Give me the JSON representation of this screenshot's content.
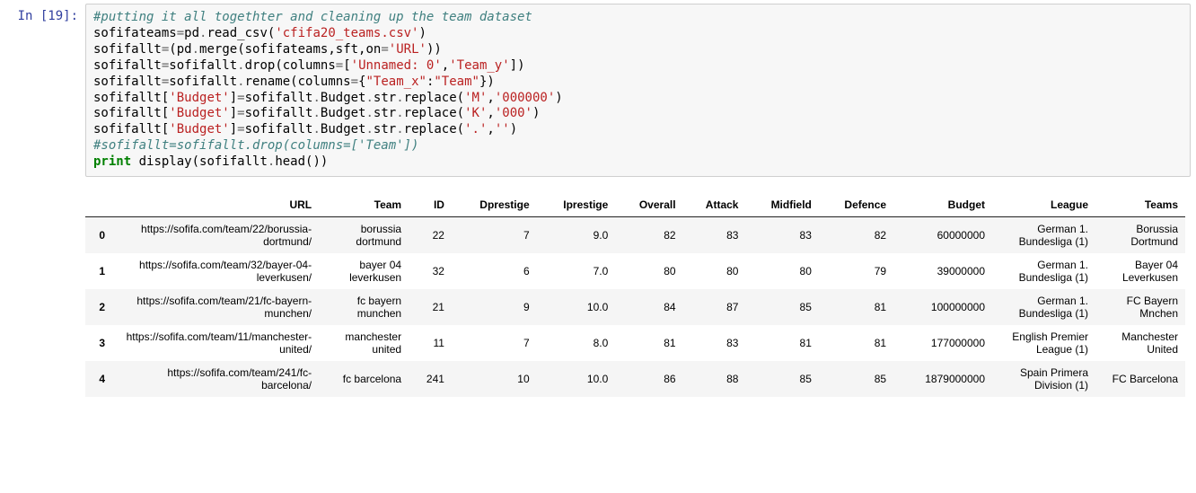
{
  "prompt": "In [19]:",
  "code": {
    "line1_comment": "#putting it all togethter and cleaning up the team dataset",
    "l2a": "sofifateams",
    "l2b": "pd",
    "l2c": "read_csv",
    "l2d": "'cfifa20_teams.csv'",
    "l3a": "sofifallt",
    "l3b": "pd",
    "l3c": "merge",
    "l3d": "sofifateams,sft,on",
    "l3e": "'URL'",
    "l4a": "sofifallt",
    "l4b": "sofifallt",
    "l4c": "drop",
    "l4d": "columns",
    "l4e": "'Unnamed: 0'",
    "l4f": "'Team_y'",
    "l5a": "sofifallt",
    "l5b": "sofifallt",
    "l5c": "rename",
    "l5d": "columns",
    "l5e": "\"Team_x\"",
    "l5f": "\"Team\"",
    "l6a": "sofifallt[",
    "l6b": "'Budget'",
    "l6c": "sofifallt",
    "l6d": "Budget",
    "l6e": "str",
    "l6f": "replace",
    "l6g": "'M'",
    "l6h": "'000000'",
    "l7g": "'K'",
    "l7h": "'000'",
    "l8g": "'.'",
    "l8h": "''",
    "l9_comment": "#sofifallt=sofifallt.drop(columns=['Team'])",
    "l10_kw": "print",
    "l10_rest": " display(sofifallt",
    "l10_head": "head",
    "l10_end": "())"
  },
  "table": {
    "headers": [
      "",
      "URL",
      "Team",
      "ID",
      "Dprestige",
      "Iprestige",
      "Overall",
      "Attack",
      "Midfield",
      "Defence",
      "Budget",
      "League",
      "Teams"
    ],
    "rows": [
      {
        "idx": "0",
        "URL": "https://sofifa.com/team/22/borussia-dortmund/",
        "Team": "borussia dortmund",
        "ID": "22",
        "Dprestige": "7",
        "Iprestige": "9.0",
        "Overall": "82",
        "Attack": "83",
        "Midfield": "83",
        "Defence": "82",
        "Budget": "60000000",
        "League": "German 1. Bundesliga (1)",
        "Teams": "Borussia Dortmund"
      },
      {
        "idx": "1",
        "URL": "https://sofifa.com/team/32/bayer-04-leverkusen/",
        "Team": "bayer 04 leverkusen",
        "ID": "32",
        "Dprestige": "6",
        "Iprestige": "7.0",
        "Overall": "80",
        "Attack": "80",
        "Midfield": "80",
        "Defence": "79",
        "Budget": "39000000",
        "League": "German 1. Bundesliga (1)",
        "Teams": "Bayer 04 Leverkusen"
      },
      {
        "idx": "2",
        "URL": "https://sofifa.com/team/21/fc-bayern-munchen/",
        "Team": "fc bayern munchen",
        "ID": "21",
        "Dprestige": "9",
        "Iprestige": "10.0",
        "Overall": "84",
        "Attack": "87",
        "Midfield": "85",
        "Defence": "81",
        "Budget": "100000000",
        "League": "German 1. Bundesliga (1)",
        "Teams": "FC Bayern Mnchen"
      },
      {
        "idx": "3",
        "URL": "https://sofifa.com/team/11/manchester-united/",
        "Team": "manchester united",
        "ID": "11",
        "Dprestige": "7",
        "Iprestige": "8.0",
        "Overall": "81",
        "Attack": "83",
        "Midfield": "81",
        "Defence": "81",
        "Budget": "177000000",
        "League": "English Premier League (1)",
        "Teams": "Manchester United"
      },
      {
        "idx": "4",
        "URL": "https://sofifa.com/team/241/fc-barcelona/",
        "Team": "fc barcelona",
        "ID": "241",
        "Dprestige": "10",
        "Iprestige": "10.0",
        "Overall": "86",
        "Attack": "88",
        "Midfield": "85",
        "Defence": "85",
        "Budget": "1879000000",
        "League": "Spain Primera Division (1)",
        "Teams": "FC Barcelona"
      }
    ]
  }
}
